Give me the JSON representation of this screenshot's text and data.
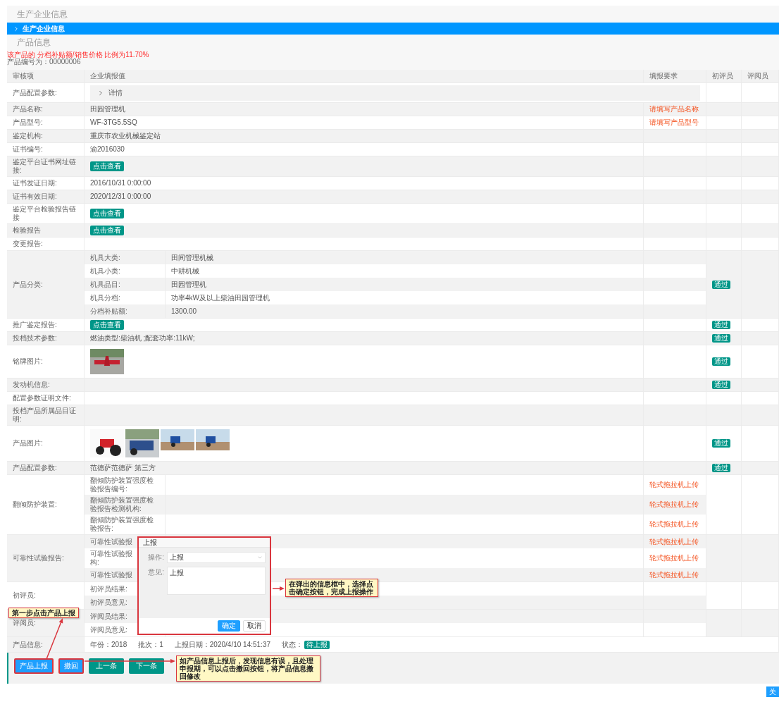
{
  "page_title": "生产企业信息",
  "company_section": {
    "title": "生产企业信息",
    "expanded": false
  },
  "product_title": "产品信息",
  "subsidy_note": "该产品的 分档补贴额/销售价格 比例为11.70%",
  "product_number": "产品编号为：00000006",
  "table": {
    "columns": [
      "审核项",
      "企业填报值",
      "填报要求",
      "初评员",
      "评阅员"
    ],
    "rows": [
      {
        "kind": "detail",
        "label": "产品配置参数:",
        "detail": {
          "label": "详情",
          "expanded": false
        }
      },
      {
        "kind": "text",
        "label": "产品名称:",
        "value": "田园管理机",
        "requirement": "请填写产品名称"
      },
      {
        "kind": "text",
        "label": "产品型号:",
        "value": "WF-3TG5.5SQ",
        "requirement": "请填写产品型号"
      },
      {
        "kind": "text",
        "label": "鉴定机构:",
        "value": "重庆市农业机械鉴定站"
      },
      {
        "kind": "text",
        "label": "证书编号:",
        "value": "渝2016030"
      },
      {
        "kind": "link",
        "label": "鉴定平台证书网址链接:",
        "link": "点击查看"
      },
      {
        "kind": "text",
        "label": "证书发证日期:",
        "value": "2016/10/31 0:00:00"
      },
      {
        "kind": "text",
        "label": "证书有效日期:",
        "value": "2020/12/31 0:00:00"
      },
      {
        "kind": "link",
        "label": "鉴定平台检验报告链接",
        "link": "点击查看"
      },
      {
        "kind": "link",
        "label": "检验报告",
        "link": "点击查看"
      },
      {
        "kind": "empty",
        "label": "变更报告:"
      },
      {
        "kind": "group",
        "label": "产品分类:",
        "first_review": "通过",
        "items": [
          {
            "label": "机具大类:",
            "value": "田间管理机械"
          },
          {
            "label": "机具小类:",
            "value": "中耕机械"
          },
          {
            "label": "机具品目:",
            "value": "田园管理机"
          },
          {
            "label": "机具分档:",
            "value": "功率4kW及以上柴油田园管理机"
          },
          {
            "label": "分档补贴额:",
            "value": "1300.00"
          }
        ]
      },
      {
        "kind": "link",
        "label": "推广鉴定报告:",
        "link": "点击查看",
        "first_review": "通过"
      },
      {
        "kind": "text",
        "label": "投档技术参数:",
        "value": "燃油类型:柴油机 ;配套功率:11kW;",
        "first_review": "通过"
      },
      {
        "kind": "photos",
        "label": "铭牌图片:",
        "first_review": "通过",
        "photos": [
          {
            "kind": "implement"
          }
        ]
      },
      {
        "kind": "empty",
        "label": "发动机信息:",
        "first_review": "通过"
      },
      {
        "kind": "empty",
        "label": "配置参数证明文件:"
      },
      {
        "kind": "empty",
        "label": "投档产品所属品目证明:"
      },
      {
        "kind": "photos",
        "label": "产品图片:",
        "first_review": "通过",
        "photos": [
          {
            "kind": "tractor"
          },
          {
            "kind": "street"
          },
          {
            "kind": "field"
          },
          {
            "kind": "field"
          }
        ]
      },
      {
        "kind": "text",
        "label": "产品配置参数:",
        "value": "范德萨范德萨 第三方",
        "first_review": "通过"
      },
      {
        "kind": "group",
        "label": "翻倾防护装置:",
        "items": [
          {
            "label": "翻倾防护装置强度检验报告编号:",
            "requirement": "轮式拖拉机上传"
          },
          {
            "label": "翻倾防护装置强度检验报告检测机构:",
            "requirement": "轮式拖拉机上传"
          },
          {
            "label": "翻倾防护装置强度检验报告:",
            "requirement": "轮式拖拉机上传"
          }
        ]
      },
      {
        "kind": "group",
        "label": "可靠性试验报告:",
        "items": [
          {
            "label": "可靠性试验报",
            "requirement": "轮式拖拉机上传"
          },
          {
            "label": "可靠性试验报",
            "label_2": "构:",
            "requirement": "轮式拖拉机上传"
          },
          {
            "label": "可靠性试验报",
            "requirement": "轮式拖拉机上传"
          }
        ]
      },
      {
        "kind": "group",
        "label": "初评员:",
        "items": [
          {
            "label": "初评员结果:"
          },
          {
            "label": "初评员意见:"
          }
        ]
      },
      {
        "kind": "group",
        "label": "评阅员:",
        "items": [
          {
            "label": "评阅员结果:"
          },
          {
            "label": "评阅员意见:"
          }
        ]
      }
    ]
  },
  "product_info": {
    "label": "产品信息:",
    "fields": [
      "年份：2018",
      "批次：1",
      "上报日期：2020/4/10 14:51:37"
    ],
    "status_label": "状态：",
    "status": "待上报"
  },
  "actions": [
    {
      "label": "产品上报",
      "kind": "primary",
      "highlighted": true
    },
    {
      "label": "撤回",
      "kind": "primary",
      "highlighted": true
    },
    {
      "label": "上一条",
      "kind": "nav",
      "highlighted": false
    },
    {
      "label": "下一条",
      "kind": "nav",
      "highlighted": false
    }
  ],
  "dialog": {
    "title": "上报",
    "fields": [
      {
        "label": "操作:",
        "kind": "select",
        "value": "上报"
      },
      {
        "label": "意见:",
        "kind": "textarea",
        "value": "上报"
      }
    ],
    "buttons": [
      {
        "label": "确定",
        "primary": true
      },
      {
        "label": "取消",
        "primary": false
      }
    ]
  },
  "callouts": [
    "在弹出的信息框中，选择点击确定按钮，完成上报操作",
    "第一步点击产品上报",
    "如产品信息上报后，发现信息有误，且处理申报期，可以点击撤回按钮，将产品信息撤回修改"
  ],
  "close_button": "关"
}
